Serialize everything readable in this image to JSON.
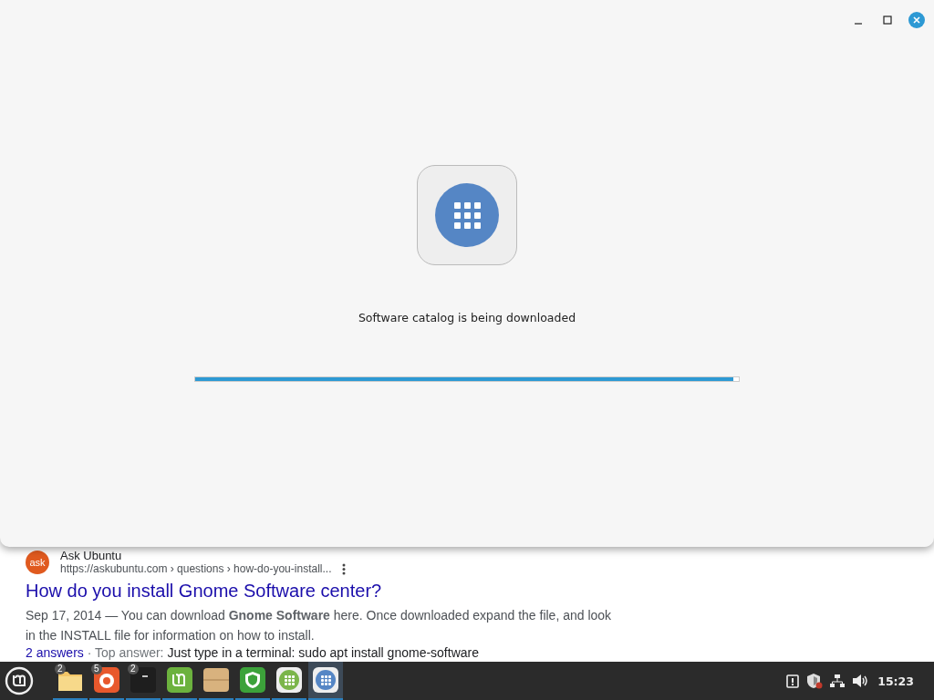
{
  "dialog": {
    "message": "Software catalog is being downloaded",
    "progress": {
      "level": 0.99
    }
  },
  "search_result": {
    "site": "Ask Ubuntu",
    "url": "https://askubuntu.com › questions › how-do-you-install...",
    "favicon": "ask",
    "title": "How do you install Gnome Software center?",
    "snippet": "Sep 17, 2014 — You can download **Gnome Software** here. Once downloaded expand the file, and look in the INSTALL file for information on how to install.",
    "answers": "2 answers",
    "top_label": "· Top answer:",
    "top_answer": "Just type in a terminal: sudo apt install gnome-software"
  },
  "taskbar": {
    "apps": [
      {
        "kind": "folder",
        "badge": "2",
        "selected": false
      },
      {
        "kind": "browser",
        "badge": "5",
        "selected": false
      },
      {
        "kind": "terminal",
        "badge": "2",
        "selected": false
      },
      {
        "kind": "mint",
        "selected": false
      },
      {
        "kind": "box",
        "selected": false
      },
      {
        "kind": "shield",
        "selected": false
      },
      {
        "kind": "software-green",
        "selected": false
      },
      {
        "kind": "software-blue",
        "selected": true
      }
    ],
    "clock": "15:23"
  }
}
